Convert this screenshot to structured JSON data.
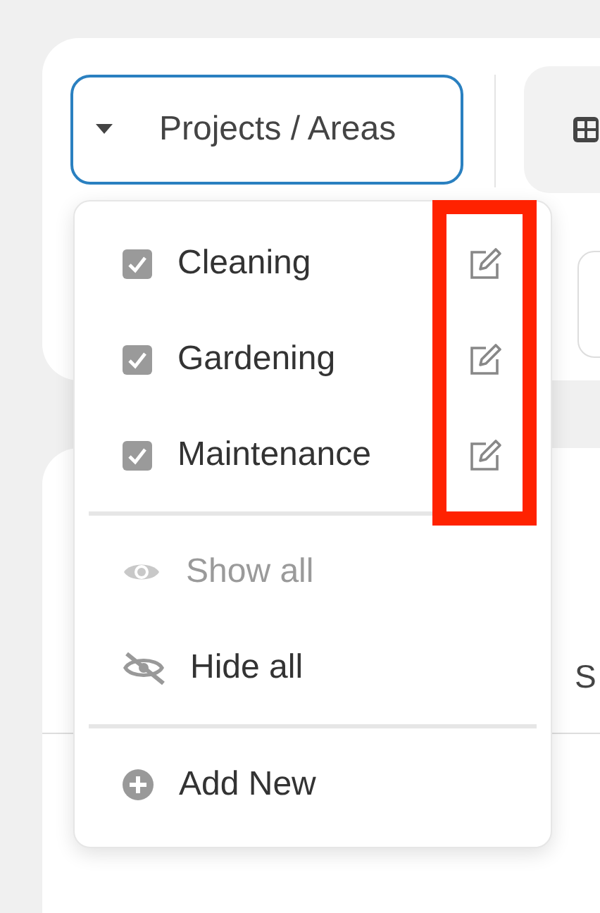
{
  "dropdown": {
    "label": "Projects / Areas",
    "expanded": true
  },
  "projects": [
    {
      "label": "Cleaning",
      "checked": true
    },
    {
      "label": "Gardening",
      "checked": true
    },
    {
      "label": "Maintenance",
      "checked": true
    }
  ],
  "actions": [
    {
      "kind": "show",
      "label": "Show all",
      "disabled": true
    },
    {
      "kind": "hide",
      "label": "Hide all",
      "disabled": false
    }
  ],
  "add": {
    "label": "Add New"
  },
  "background_text": "S"
}
